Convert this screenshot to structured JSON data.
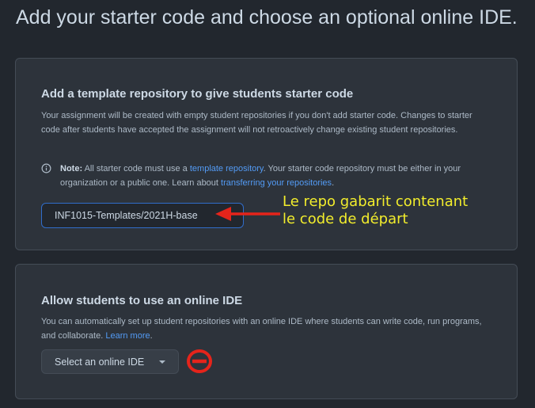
{
  "page_title": "Add your starter code and choose an optional online IDE.",
  "template_section": {
    "heading": "Add a template repository to give students starter code",
    "description": "Your assignment will be created with empty student repositories if you don't add starter code. Changes to starter code after students have accepted the assignment will not retroactively change existing student repositories.",
    "note_label": "Note:",
    "note_text_1": "All starter code must use a",
    "note_link_1": "template repository",
    "note_text_2": ". Your starter code repository must be either in your organization or a public one. Learn about",
    "note_link_2": "transferring your repositories",
    "note_text_3": ".",
    "repo_value": "INF1015-Templates/2021H-base"
  },
  "ide_section": {
    "heading": "Allow students to use an online IDE",
    "description": "You can automatically set up student repositories with an online IDE where students can write code, run programs, and collaborate.",
    "learn_more": "Learn more",
    "learn_more_suffix": ".",
    "select_label": "Select an online IDE"
  },
  "annotation": {
    "line1": "Le repo gabarit contenant",
    "line2": "le code de départ",
    "color": "#f2ed2c"
  },
  "icons": {
    "info": "info-icon",
    "caret": "chevron-down-icon",
    "prohibited": "prohibited-icon",
    "arrow": "red-arrow-icon"
  },
  "colors": {
    "background": "#22272e",
    "card": "#2d333b",
    "link": "#539bf5",
    "annotation_red": "#e5241b"
  }
}
